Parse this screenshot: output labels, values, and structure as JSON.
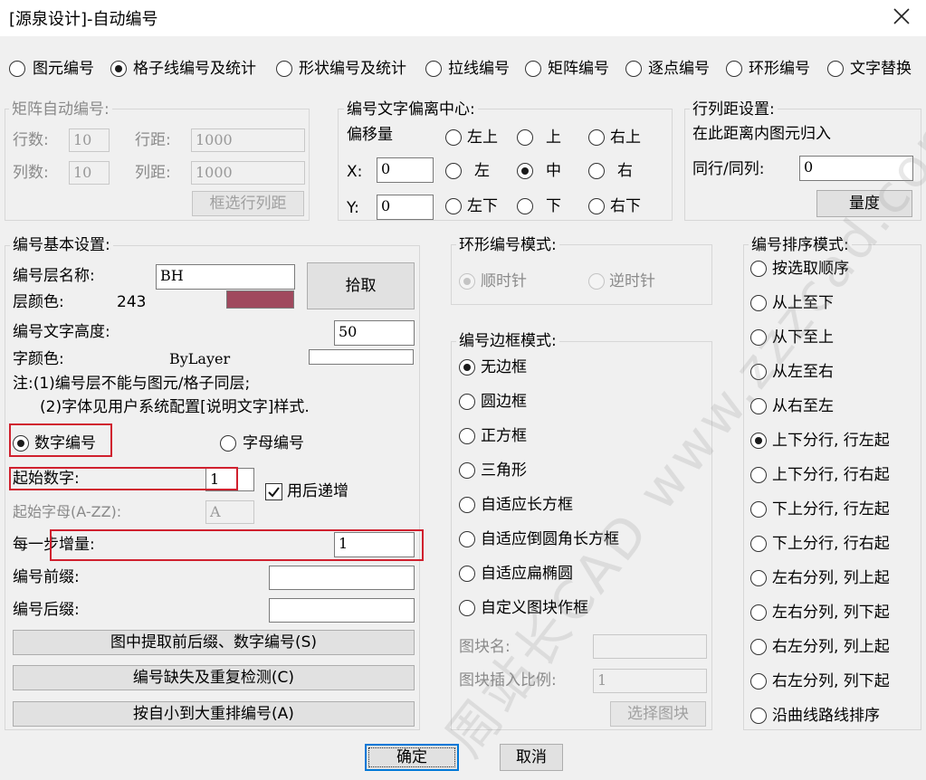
{
  "window": {
    "title": "[源泉设计]-自动编号",
    "close_icon": "close-icon"
  },
  "tabs": [
    {
      "label": "图元编号",
      "selected": false
    },
    {
      "label": "格子线编号及统计",
      "selected": true
    },
    {
      "label": "形状编号及统计",
      "selected": false
    },
    {
      "label": "拉线编号",
      "selected": false
    },
    {
      "label": "矩阵编号",
      "selected": false
    },
    {
      "label": "逐点编号",
      "selected": false
    },
    {
      "label": "环形编号",
      "selected": false
    },
    {
      "label": "文字替换",
      "selected": false
    }
  ],
  "matrix": {
    "title": "矩阵自动编号:",
    "rows_label": "行数:",
    "rows_value": "10",
    "row_dist_label": "行距:",
    "row_dist_value": "1000",
    "cols_label": "列数:",
    "cols_value": "10",
    "col_dist_label": "列距:",
    "col_dist_value": "1000",
    "select_btn": "框选行列距"
  },
  "offset": {
    "title": "编号文字偏离中心:",
    "offset_label": "偏移量",
    "x_label": "X:",
    "x_value": "0",
    "y_label": "Y:",
    "y_value": "0",
    "positions": [
      "左上",
      "上",
      "右上",
      "左",
      "中",
      "右",
      "左下",
      "下",
      "右下"
    ],
    "selected": "中"
  },
  "spacing": {
    "title": "行列距设置:",
    "desc": "在此距离内图元归入",
    "same_label": "同行/同列:",
    "same_value": "0",
    "measure_btn": "量度"
  },
  "basic": {
    "title": "编号基本设置:",
    "layer_name_label": "编号层名称:",
    "layer_name_value": "BH",
    "pick_btn": "拾取",
    "layer_color_label": "层颜色:",
    "layer_color_value": "243",
    "layer_color_hex": "#a0495e",
    "text_height_label": "编号文字高度:",
    "text_height_value": "50",
    "font_color_label": "字颜色:",
    "font_color_value": "ByLayer",
    "note1": "注:(1)编号层不能与图元/格子同层;",
    "note2": "(2)字体见用户系统配置[说明文字]样式.",
    "num_mode": "数字编号",
    "alpha_mode": "字母编号",
    "start_num_label": "起始数字:",
    "start_num_value": "1",
    "increment_after_label": "用后递增",
    "start_letter_label": "起始字母(A-ZZ):",
    "start_letter_value": "A",
    "step_label": "每一步增量:",
    "step_value": "1",
    "prefix_label": "编号前缀:",
    "prefix_value": "",
    "suffix_label": "编号后缀:",
    "suffix_value": "",
    "extract_btn": "图中提取前后缀、数字编号(S)",
    "check_btn": "编号缺失及重复检测(C)",
    "reorder_btn": "按自小到大重排编号(A)"
  },
  "ring_mode": {
    "title": "环形编号模式:",
    "clockwise": "顺时针",
    "counter": "逆时针"
  },
  "border_mode": {
    "title": "编号边框模式:",
    "options": [
      "无边框",
      "圆边框",
      "正方框",
      "三角形",
      "自适应长方框",
      "自适应倒圆角长方框",
      "自适应扁椭圆",
      "自定义图块作框"
    ],
    "selected": "无边框",
    "block_name_label": "图块名:",
    "block_name_value": "",
    "block_scale_label": "图块插入比例:",
    "block_scale_value": "1",
    "select_block_btn": "选择图块"
  },
  "sort_mode": {
    "title": "编号排序模式:",
    "options": [
      "按选取顺序",
      "从上至下",
      "从下至上",
      "从左至右",
      "从右至左",
      "上下分行, 行左起",
      "上下分行, 行右起",
      "下上分行, 行左起",
      "下上分行, 行右起",
      "左右分列, 列上起",
      "左右分列, 列下起",
      "右左分列, 列上起",
      "右左分列, 列下起",
      "沿曲线路线排序"
    ],
    "selected": "上下分行, 行左起"
  },
  "footer": {
    "ok": "确定",
    "cancel": "取消"
  },
  "watermark": "周站长CAD www.zzzcad.com"
}
